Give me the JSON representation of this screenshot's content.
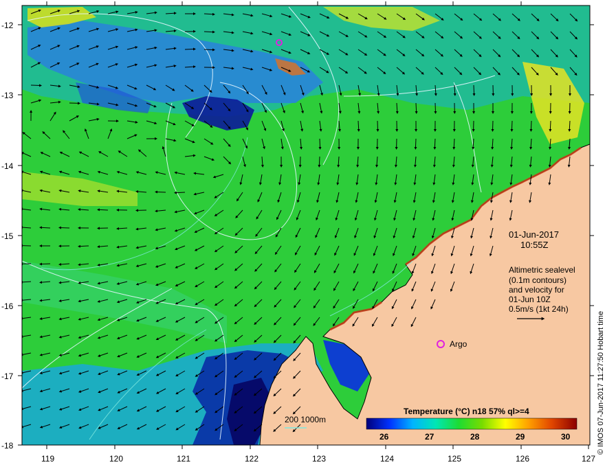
{
  "map": {
    "type": "sea-surface-temperature-map",
    "lat_ticks": [
      "-12",
      "-13",
      "-14",
      "-15",
      "-16",
      "-17",
      "-18"
    ],
    "lon_ticks": [
      "119",
      "120",
      "121",
      "122",
      "123",
      "124",
      "125",
      "126",
      "127"
    ],
    "date_line": "01-Jun-2017",
    "time_line": "10:55Z",
    "sealevel_lines": [
      "Altimetric sealevel",
      "(0.1m contours)",
      "and velocity for",
      "01-Jun 10Z",
      "0.5m/s (1kt 24h)"
    ],
    "argo_label": "Argo",
    "bathy_label": "200  1000m",
    "colorbar": {
      "title": "Temperature (°C) n18 57% ql>=4",
      "ticks": [
        "26",
        "27",
        "28",
        "29",
        "30"
      ],
      "colors": [
        "#00007a",
        "#0032ff",
        "#00b4ff",
        "#00e6b4",
        "#1edc32",
        "#78dc00",
        "#ffff00",
        "#ffa000",
        "#e14600",
        "#8c0000"
      ]
    },
    "credit": "© IMOS 07-Jun-2017 11:27:50 Hobart time",
    "colors": {
      "land": "#f7c8a2",
      "ocean_green": "#2dcd3a",
      "cold_blue": "#0a3aa8",
      "cyan": "#16b8c9",
      "argo": "#e020e0"
    }
  }
}
